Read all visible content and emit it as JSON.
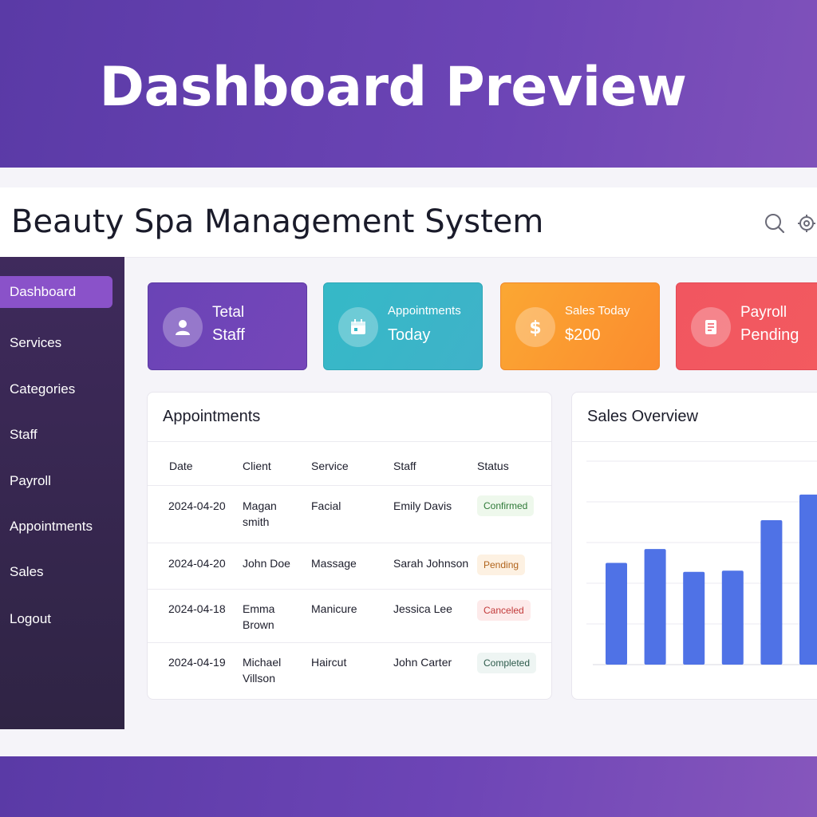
{
  "banner": {
    "title": "Dashboard Preview"
  },
  "header": {
    "title": "Beauty Spa Management System",
    "icons": [
      "search-icon",
      "settings-icon"
    ]
  },
  "sidebar": {
    "items": [
      {
        "label": "Dashboard",
        "active": true
      },
      {
        "label": "Services",
        "active": false
      },
      {
        "label": "Categories",
        "active": false
      },
      {
        "label": "Staff",
        "active": false
      },
      {
        "label": "Payroll",
        "active": false
      },
      {
        "label": "Appointments",
        "active": false
      },
      {
        "label": "Sales",
        "active": false
      },
      {
        "label": "Logout",
        "active": false
      }
    ]
  },
  "stats": [
    {
      "line1": "Tetal",
      "line2": "Staff",
      "icon": "user-icon",
      "color": "#6b44b8"
    },
    {
      "line1": "Appointments",
      "line2": "Today",
      "icon": "calendar-icon",
      "color": "#34b5c6"
    },
    {
      "line1": "Sales Today",
      "line2": "$200",
      "icon": "dollar-icon",
      "color": "#fb9a2f"
    },
    {
      "line1": "Payroll",
      "line2": "Pending",
      "icon": "receipt-icon",
      "color": "#f0525f"
    }
  ],
  "appointments": {
    "title": "Appointments",
    "columns": [
      "Date",
      "Client",
      "Service",
      "Staff",
      "Status"
    ],
    "rows": [
      {
        "date": "2024-04-20",
        "client": "Magan smith",
        "service": "Facial",
        "staff": "Emily Davis",
        "status": "Confirmed",
        "status_color": "#2f7a38",
        "status_bg": "#eef8ec"
      },
      {
        "date": "2024-04-20",
        "client": "John Doe",
        "service": "Massage",
        "staff": "Sarah Johnson",
        "status": "Pending",
        "status_color": "#b1641c",
        "status_bg": "#fdf1e2"
      },
      {
        "date": "2024-04-18",
        "client": "Emma Brown",
        "service": "Manicure",
        "staff": "Jessica Lee",
        "status": "Canceled",
        "status_color": "#c23a3a",
        "status_bg": "#fdeaea"
      },
      {
        "date": "2024-04-19",
        "client": "Michael Villson",
        "service": "Haircut",
        "staff": "John Carter",
        "status": "Completed",
        "status_color": "#2e5b4c",
        "status_bg": "#eef5f3"
      }
    ]
  },
  "sales": {
    "title": "Sales Overview"
  },
  "chart_data": {
    "type": "bar",
    "title": "Sales Overview",
    "categories": [],
    "values": [
      25,
      28.4,
      22.8,
      23.1,
      35.5,
      41.8
    ],
    "ylim": [
      0,
      50
    ],
    "grid": true,
    "bar_color": "#4f72e6"
  }
}
